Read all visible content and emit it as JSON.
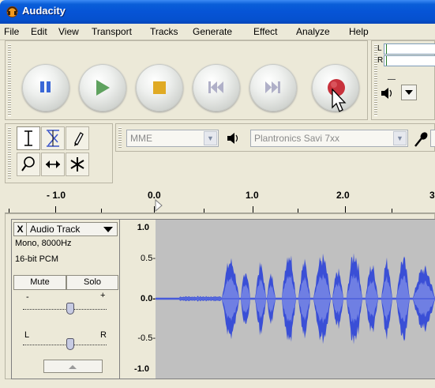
{
  "window": {
    "title": "Audacity"
  },
  "menu": [
    "File",
    "Edit",
    "View",
    "Transport",
    "Tracks",
    "Generate",
    "Effect",
    "Analyze",
    "Help"
  ],
  "transport": {
    "buttons": [
      {
        "name": "pause",
        "icon": "pause-icon",
        "color": "#3a67d7"
      },
      {
        "name": "play",
        "icon": "play-icon",
        "color": "#5fa25f"
      },
      {
        "name": "stop",
        "icon": "stop-icon",
        "color": "#e0aa24"
      },
      {
        "name": "skip-start",
        "icon": "skip-start-icon",
        "color": "#b0b0c8"
      },
      {
        "name": "skip-end",
        "icon": "skip-end-icon",
        "color": "#b0b0c8"
      },
      {
        "name": "record",
        "icon": "record-icon",
        "color": "#c8323c"
      }
    ]
  },
  "meter": {
    "left_label": "L",
    "right_label": "R"
  },
  "device": {
    "host": "MME",
    "output": "Plantronics Savi 7xx"
  },
  "ruler": {
    "labels": [
      "- 1.0",
      "0.0",
      "1.0",
      "2.0",
      "3"
    ]
  },
  "track": {
    "name": "Audio Track",
    "close": "X",
    "format_line1": "Mono, 8000Hz",
    "format_line2": "16-bit PCM",
    "mute": "Mute",
    "solo": "Solo",
    "gain_minus": "-",
    "gain_plus": "+",
    "pan_left": "L",
    "pan_right": "R"
  },
  "vertical_ruler": [
    "1.0",
    "0.5-",
    "0.0-",
    "-0.5-",
    "-1.0"
  ],
  "colors": {
    "titlebar": "#0654d6",
    "wave_outer": "#3a4fd6",
    "wave_inner": "#6f7fe3",
    "wave_bg": "#c0c0c0"
  }
}
